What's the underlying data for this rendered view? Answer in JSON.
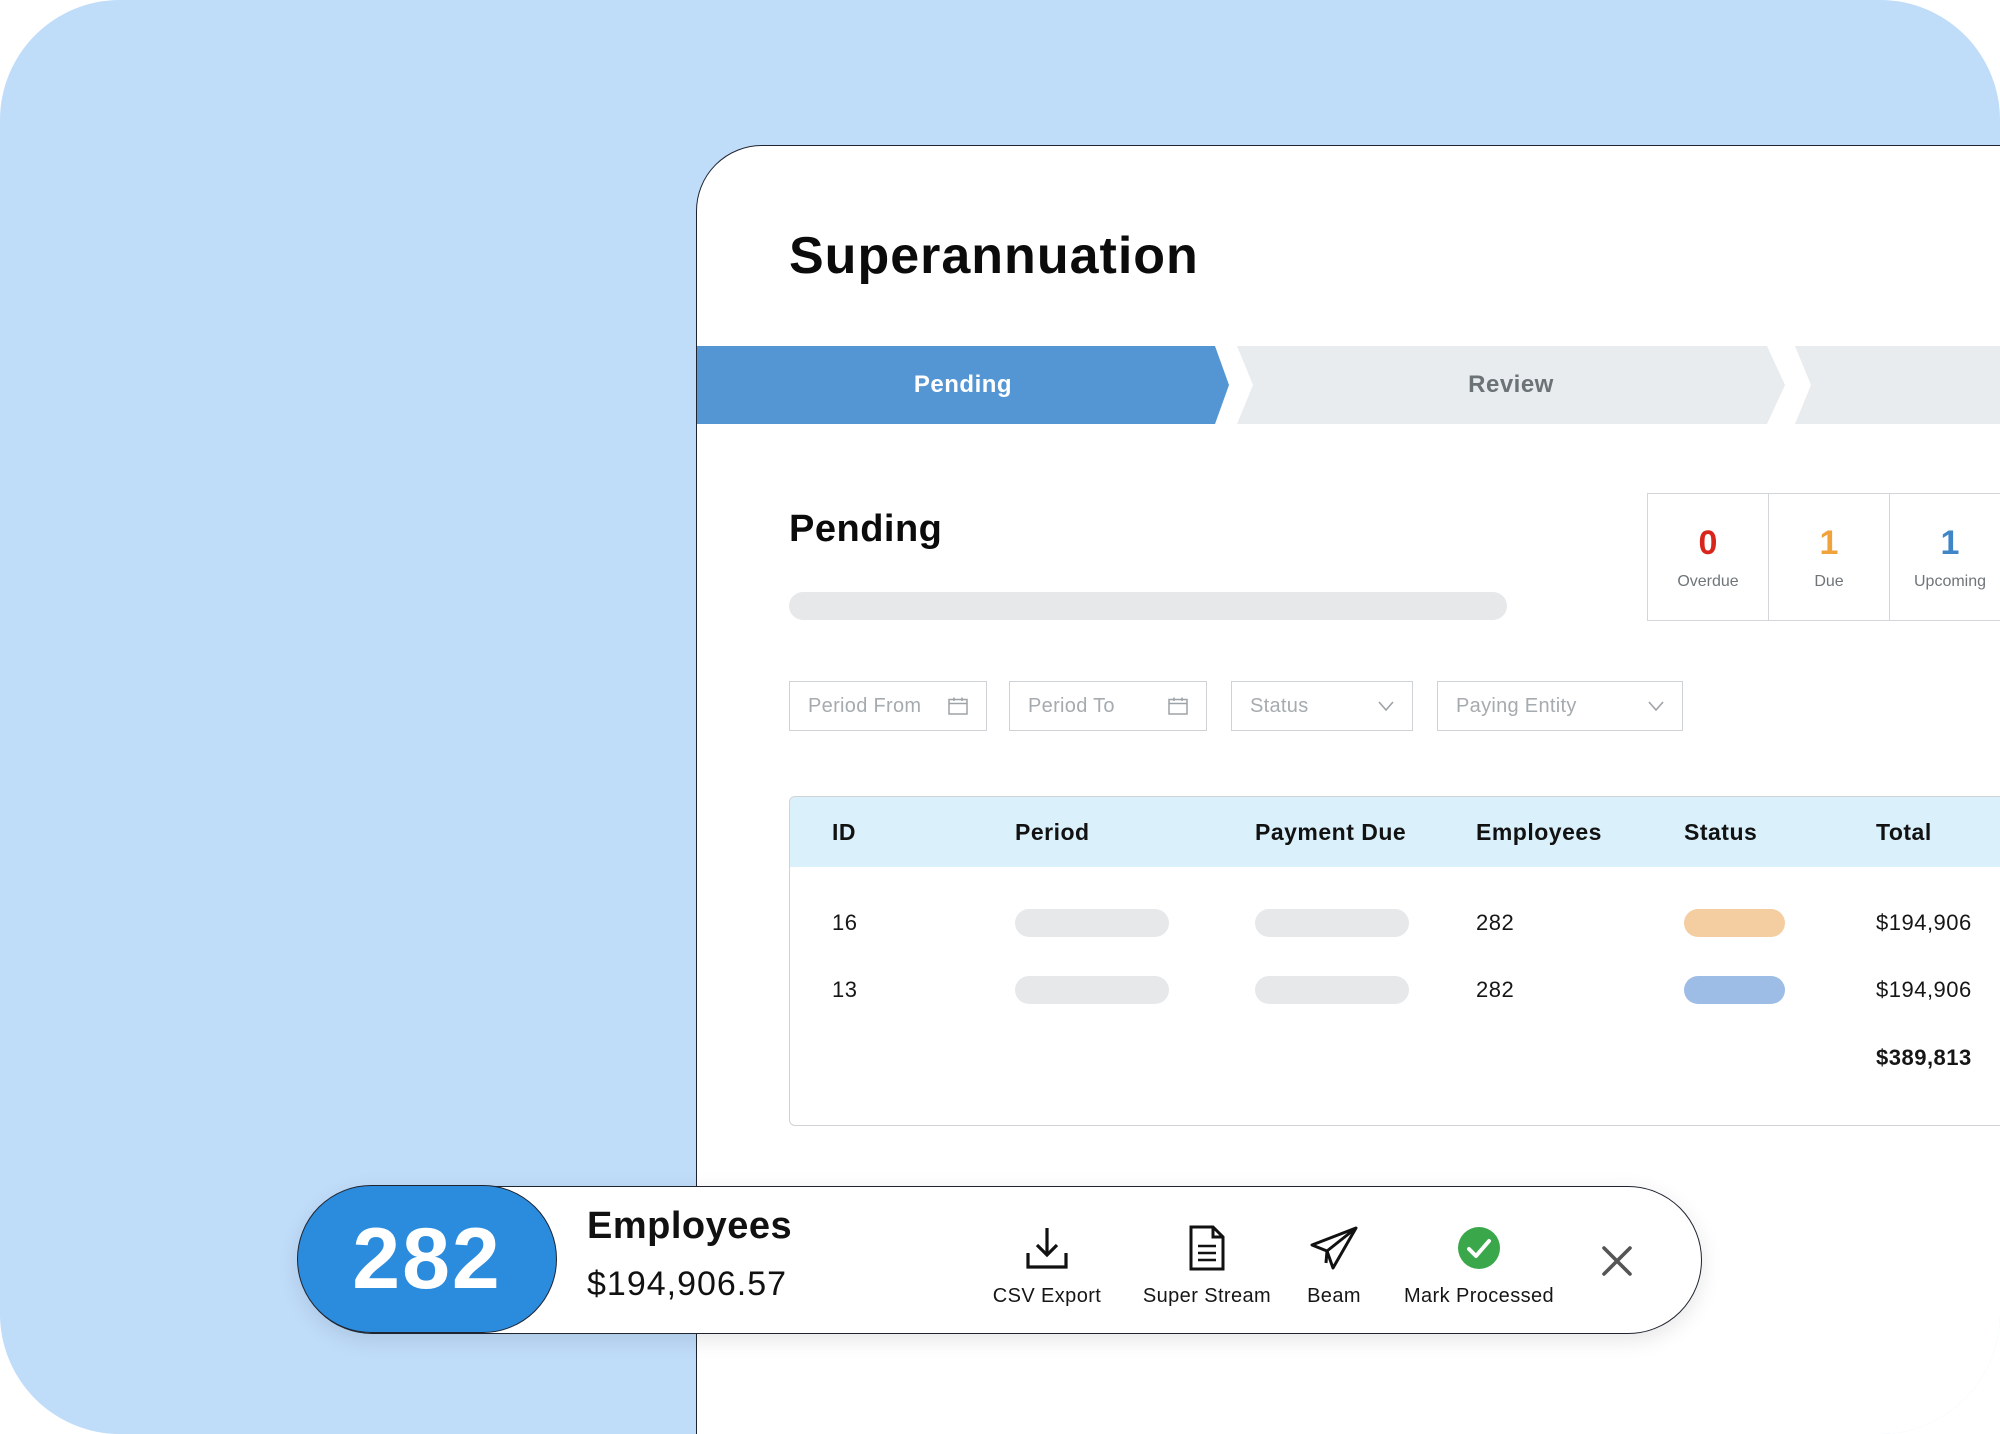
{
  "page": {
    "title": "Superannuation"
  },
  "steps": [
    {
      "label": "Pending",
      "active": true
    },
    {
      "label": "Review",
      "active": false
    },
    {
      "label": "",
      "active": false
    }
  ],
  "section": {
    "title": "Pending"
  },
  "stats": [
    {
      "value": "0",
      "label": "Overdue",
      "color": "#d9261c"
    },
    {
      "value": "1",
      "label": "Due",
      "color": "#f0a23b"
    },
    {
      "value": "1",
      "label": "Upcoming",
      "color": "#3f86c7"
    }
  ],
  "filters": {
    "period_from": {
      "placeholder": "Period From",
      "icon": "calendar-icon"
    },
    "period_to": {
      "placeholder": "Period To",
      "icon": "calendar-icon"
    },
    "status": {
      "placeholder": "Status",
      "icon": "chevron-down-icon"
    },
    "paying_entity": {
      "placeholder": "Paying Entity",
      "icon": "chevron-down-icon"
    }
  },
  "table": {
    "columns": [
      "ID",
      "Period",
      "Payment Due",
      "Employees",
      "Status",
      "Total"
    ],
    "rows": [
      {
        "id": "16",
        "employees": "282",
        "status_color": "#f4cda0",
        "total": "$194,906"
      },
      {
        "id": "13",
        "employees": "282",
        "status_color": "#9dbde6",
        "total": "$194,906"
      }
    ],
    "grand_total": "$389,813"
  },
  "action_bar": {
    "count": "282",
    "title": "Employees",
    "amount": "$194,906.57",
    "actions": [
      {
        "label": "CSV Export",
        "icon": "download-icon"
      },
      {
        "label": "Super Stream",
        "icon": "document-icon"
      },
      {
        "label": "Beam",
        "icon": "paper-plane-icon"
      },
      {
        "label": "Mark Processed",
        "icon": "check-circle-icon"
      }
    ],
    "close_icon": "close-icon"
  },
  "colors": {
    "background": "#bfdcf9",
    "accent": "#5496d3",
    "count_pill": "#2b8bdc",
    "table_header": "#daf0fb",
    "success": "#3aa84a"
  }
}
